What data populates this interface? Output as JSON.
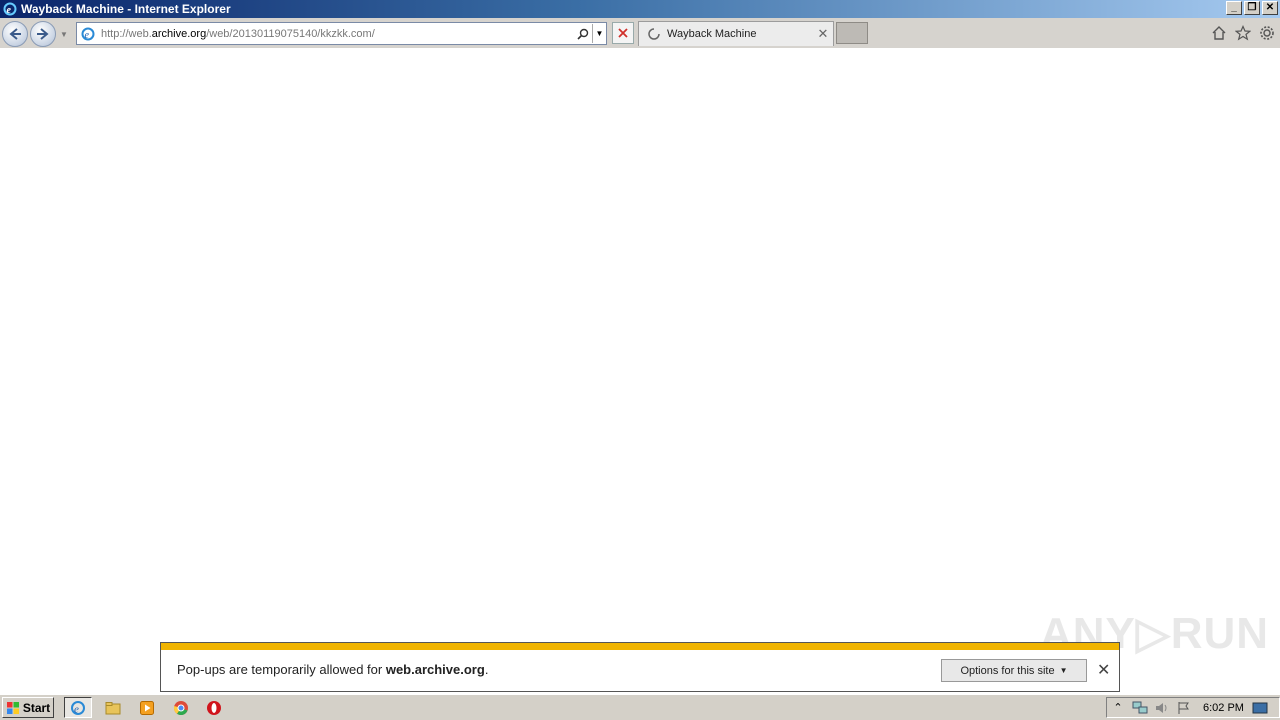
{
  "window": {
    "title": "Wayback Machine - Internet Explorer"
  },
  "address": {
    "prefix": "http://web.",
    "domain": "archive.org",
    "path": "/web/20130119075140/kkzkk.com/"
  },
  "tab": {
    "label": "Wayback Machine",
    "close": "✕"
  },
  "notification": {
    "message_prefix": "Pop-ups are temporarily allowed for ",
    "site": "web.archive.org",
    "message_suffix": ".",
    "options_label": "Options for this site",
    "close": "✕"
  },
  "watermark": "ANY▷RUN",
  "taskbar": {
    "start_label": "Start",
    "clock": "6:02 PM"
  },
  "colors": {
    "notification_accent": "#f0b400",
    "titlebar": "#0a246a"
  }
}
